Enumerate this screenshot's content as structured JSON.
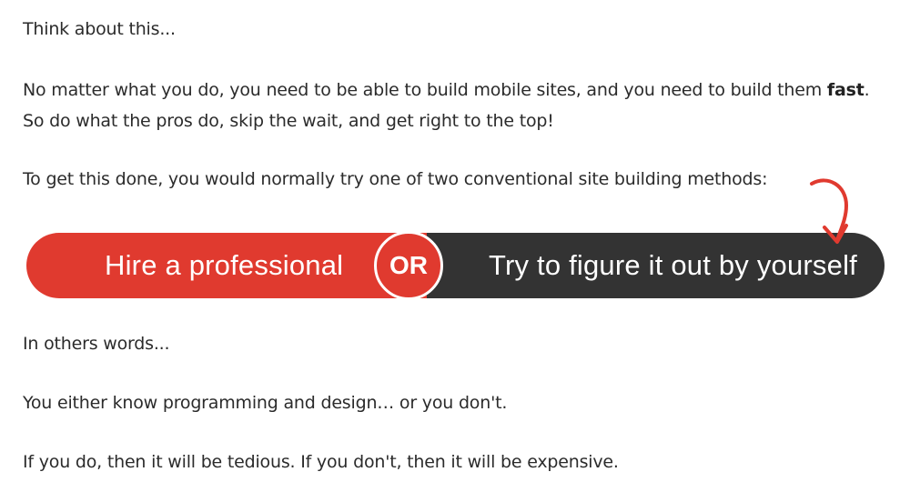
{
  "paragraphs": {
    "p1": "Think about this...",
    "p2_line1_pre": "No matter what you do, you need to be able to build mobile sites, and you need to build them ",
    "p2_line1_bold": "fast",
    "p2_line1_post": ".",
    "p2_line2": "So do what the pros do, skip the wait, and get right to the top!",
    "p3": "To get this done, you would normally try one of two conventional site building methods:",
    "p4": "In others words...",
    "p5": "You either know programming and design… or you don't.",
    "p6": "If you do, then it will be tedious. If you don't, then it will be expensive."
  },
  "choice": {
    "left_label": "Hire a professional",
    "or_label": "OR",
    "right_label": "Try to figure it out by yourself"
  },
  "colors": {
    "accent_red": "#e03a2f",
    "dark": "#333333",
    "text": "#2b2b2b"
  },
  "icons": {
    "arrow": "curved-arrow-down-icon"
  }
}
